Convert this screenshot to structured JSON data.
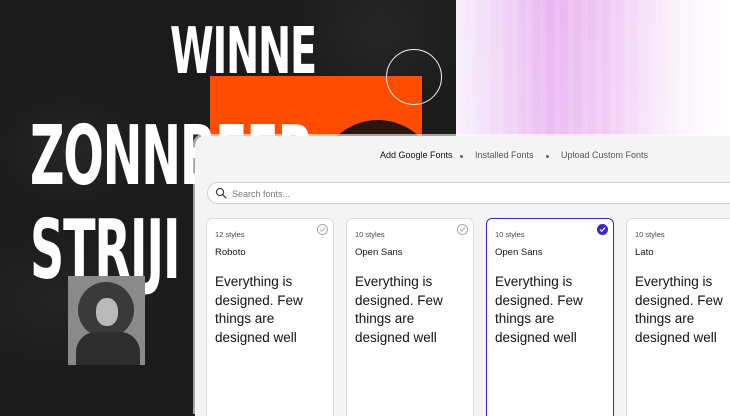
{
  "poster": {
    "words": [
      "WINNE",
      "ZONNBEER",
      "STRIJI"
    ]
  },
  "tabs": [
    {
      "label": "Add Google Fonts",
      "active": true
    },
    {
      "label": "Installed Fonts",
      "active": false
    },
    {
      "label": "Upload Custom Fonts",
      "active": false
    }
  ],
  "search": {
    "placeholder": "Search fonts..."
  },
  "cards": [
    {
      "styles": "12 styles",
      "name": "Roboto",
      "sample": "Everything is designed. Few things are designed well",
      "selected": false
    },
    {
      "styles": "10 styles",
      "name": "Open Sans",
      "sample": "Everything is designed. Few things are designed well",
      "selected": false
    },
    {
      "styles": "10 styles",
      "name": "Open Sans",
      "sample": "Everything is designed. Few things are designed well",
      "selected": true
    },
    {
      "styles": "10 styles",
      "name": "Lato",
      "sample": "Everything is designed. Few things are designed well",
      "selected": false
    }
  ],
  "colors": {
    "accent": "#3b22d6",
    "poster_orange": "#ff4d00",
    "poster_bg": "#1b1b1b"
  },
  "icons": [
    "search-icon",
    "checkmark-icon"
  ]
}
